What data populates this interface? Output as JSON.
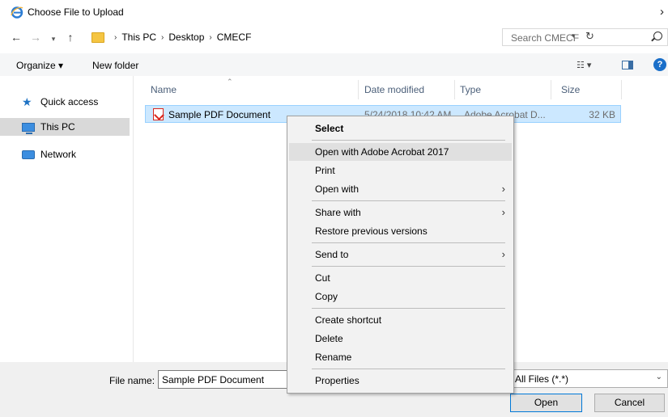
{
  "window": {
    "title": "Choose File to Upload",
    "close_glyph": "›"
  },
  "address": {
    "crumbs": [
      "This PC",
      "Desktop",
      "CMECF"
    ],
    "separator": "›",
    "search_placeholder": "Search CMECF"
  },
  "toolbar": {
    "organize_label": "Organize ▾",
    "new_folder_label": "New folder",
    "view_glyph": "☷ ▾",
    "help_glyph": "?"
  },
  "nav_pane": {
    "items": [
      {
        "label": "Quick access",
        "icon": "star-icon",
        "selected": false
      },
      {
        "label": "This PC",
        "icon": "computer-icon",
        "selected": true
      },
      {
        "label": "Network",
        "icon": "network-icon",
        "selected": false
      }
    ]
  },
  "file_list": {
    "columns": [
      "Name",
      "Date modified",
      "Type",
      "Size"
    ],
    "files": [
      {
        "name": "Sample PDF Document",
        "date_modified": "5/24/2018 10:42 AM",
        "type": "Adobe Acrobat D...",
        "size": "32 KB",
        "icon": "pdf-icon",
        "selected": true
      }
    ]
  },
  "context_menu": {
    "items": [
      {
        "label": "Select",
        "bold": true,
        "submenu": false,
        "highlighted": false
      },
      {
        "label": "Open with Adobe Acrobat 2017",
        "bold": false,
        "submenu": false,
        "highlighted": true
      },
      {
        "label": "Print",
        "bold": false,
        "submenu": false,
        "highlighted": false
      },
      {
        "label": "Open with",
        "bold": false,
        "submenu": true,
        "highlighted": false
      },
      {
        "label": "Share with",
        "bold": false,
        "submenu": true,
        "highlighted": false
      },
      {
        "label": "Restore previous versions",
        "bold": false,
        "submenu": false,
        "highlighted": false
      },
      {
        "label": "Send to",
        "bold": false,
        "submenu": true,
        "highlighted": false
      },
      {
        "label": "Cut",
        "bold": false,
        "submenu": false,
        "highlighted": false
      },
      {
        "label": "Copy",
        "bold": false,
        "submenu": false,
        "highlighted": false
      },
      {
        "label": "Create shortcut",
        "bold": false,
        "submenu": false,
        "highlighted": false
      },
      {
        "label": "Delete",
        "bold": false,
        "submenu": false,
        "highlighted": false
      },
      {
        "label": "Rename",
        "bold": false,
        "submenu": false,
        "highlighted": false
      },
      {
        "label": "Properties",
        "bold": false,
        "submenu": false,
        "highlighted": false
      }
    ]
  },
  "bottom": {
    "file_name_label": "File name:",
    "file_name_value": "Sample PDF Document",
    "file_type_filter": "All Files (*.*)",
    "open_label": "Open",
    "cancel_label": "Cancel"
  },
  "colors": {
    "selection_bg": "#cce8ff",
    "selection_border": "#99d1ff",
    "accent": "#0078d7",
    "pdf_red": "#d9261c"
  }
}
